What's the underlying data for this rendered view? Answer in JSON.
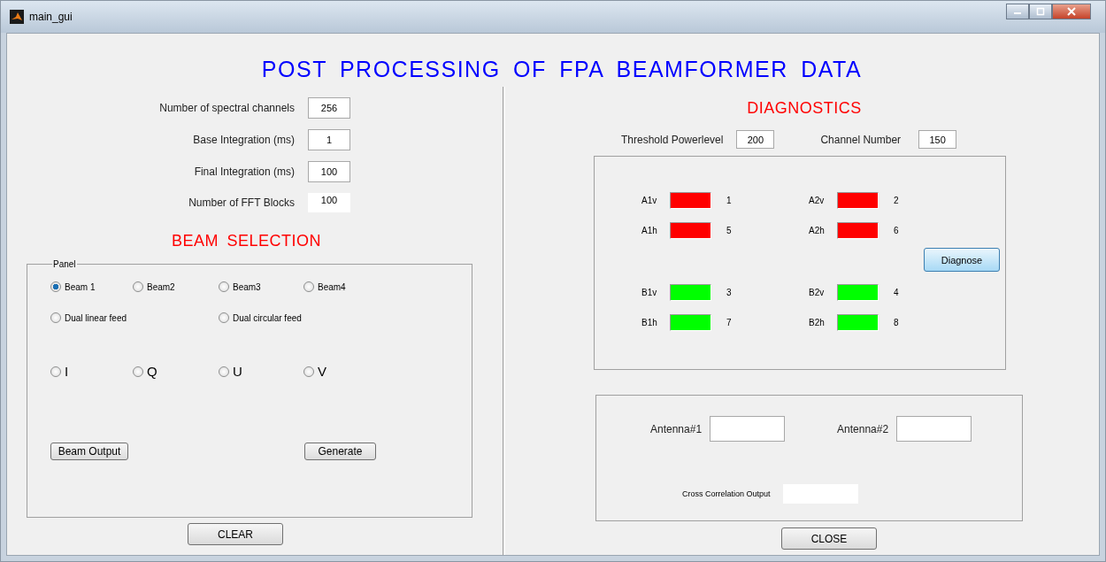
{
  "window": {
    "title": "main_gui"
  },
  "heading": "POST PROCESSING OF FPA BEAMFORMER DATA",
  "settings": [
    {
      "label": "Number of spectral channels",
      "value": "256",
      "kind": "edit"
    },
    {
      "label": "Base Integration (ms)",
      "value": "1",
      "kind": "edit"
    },
    {
      "label": "Final Integration (ms)",
      "value": "100",
      "kind": "edit"
    },
    {
      "label": "Number  of  FFT Blocks",
      "value": "100",
      "kind": "static"
    }
  ],
  "beam_selection": {
    "title": "BEAM  SELECTION",
    "panel_title": "Panel",
    "beams": [
      {
        "label": "Beam 1",
        "selected": true
      },
      {
        "label": "Beam2",
        "selected": false
      },
      {
        "label": "Beam3",
        "selected": false
      },
      {
        "label": "Beam4",
        "selected": false
      }
    ],
    "feeds": [
      {
        "label": "Dual linear feed",
        "selected": false
      },
      {
        "label": "Dual circular feed",
        "selected": false
      }
    ],
    "stokes": [
      {
        "label": "I",
        "selected": false
      },
      {
        "label": "Q",
        "selected": false
      },
      {
        "label": "U",
        "selected": false
      },
      {
        "label": "V",
        "selected": false
      }
    ],
    "buttons": [
      "Beam Output",
      "Generate"
    ]
  },
  "clear_button": "CLEAR",
  "diagnostics": {
    "title": "DIAGNOSTICS",
    "threshold": {
      "label": "Threshold Powerlevel",
      "value": "200"
    },
    "channel": {
      "label": "Channel Number",
      "value": "150"
    },
    "indicator_groups": [
      [
        {
          "label": "A1v",
          "color": "#ff0000",
          "number": "1"
        },
        {
          "label": "A2v",
          "color": "#ff0000",
          "number": "2"
        },
        {
          "label": "A1h",
          "color": "#ff0000",
          "number": "5"
        },
        {
          "label": "A2h",
          "color": "#ff0000",
          "number": "6"
        }
      ],
      [
        {
          "label": "B1v",
          "color": "#00ff00",
          "number": "3"
        },
        {
          "label": "B2v",
          "color": "#00ff00",
          "number": "4"
        },
        {
          "label": "B1h",
          "color": "#00ff00",
          "number": "7"
        },
        {
          "label": "B2h",
          "color": "#00ff00",
          "number": "8"
        }
      ]
    ],
    "diagnose_button": "Diagnose"
  },
  "correlation": {
    "antenna1_label": "Antenna#1",
    "antenna2_label": "Antenna#2",
    "output_label": "Cross Correlation Output"
  },
  "close_button": "CLOSE"
}
